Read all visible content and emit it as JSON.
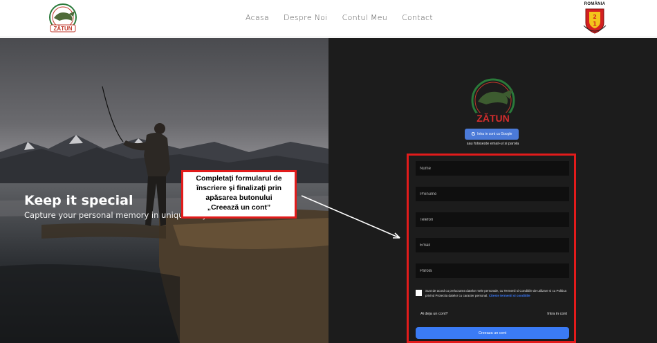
{
  "header": {
    "logo": {
      "text": "ZĂTUN",
      "icon": "fish-logo-icon"
    },
    "nav": [
      {
        "label": "Acasa"
      },
      {
        "label": "Despre Noi"
      },
      {
        "label": "Contul Meu"
      },
      {
        "label": "Contact"
      }
    ],
    "crest": {
      "title": "ROMÂNIA",
      "icon": "coat-of-arms-icon"
    }
  },
  "hero": {
    "title": "Keep it special",
    "subtitle": "Capture your personal memory in unique way"
  },
  "panel": {
    "logo_text": "ZĂTUN",
    "google_button": "Intra in cont cu Google",
    "google_icon_glyph": "G",
    "alt_text": "sau foloseste email-ul si parola",
    "fields": [
      {
        "placeholder": "Nume"
      },
      {
        "placeholder": "Prenume"
      },
      {
        "placeholder": "Telefon"
      },
      {
        "placeholder": "Email"
      },
      {
        "placeholder": "Parola"
      }
    ],
    "agree_text": "Sunt de acord cu prelucrarea datelor mele personale, cu Termenii si Conditiile de utilizare si cu Politica privind Protectia datelor cu caracter personal.",
    "agree_link": "Citeste termenii si conditiile",
    "have_account": "Ai deja un cont?",
    "login_link": "Intra in cont",
    "create_button": "Creeaza un cont"
  },
  "callout": {
    "lines": [
      "Completați formularul de",
      "înscriere și finalizați prin",
      "apăsarea butonului",
      "„Creează un cont”"
    ]
  },
  "colors": {
    "callout_border": "#e21b1b",
    "primary_button": "#3b7bf5",
    "panel_bg": "#1c1c1c"
  }
}
